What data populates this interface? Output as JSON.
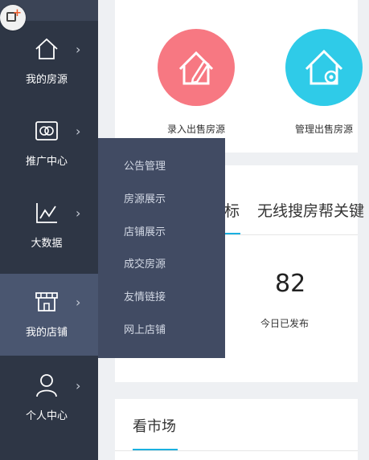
{
  "sidebar": {
    "items": [
      {
        "label": "我的房源",
        "icon": "house-icon"
      },
      {
        "label": "推广中心",
        "icon": "promotion-icon"
      },
      {
        "label": "大数据",
        "icon": "chart-icon"
      },
      {
        "label": "我的店铺",
        "icon": "store-icon"
      },
      {
        "label": "个人中心",
        "icon": "user-icon"
      }
    ]
  },
  "flyout": {
    "items": [
      "公告管理",
      "房源展示",
      "店铺展示",
      "成交房源",
      "友情链接",
      "网上店铺"
    ]
  },
  "quick_actions": [
    {
      "label": "录入出售房源",
      "icon": "house-edit-icon",
      "color": "#f77882"
    },
    {
      "label": "管理出售房源",
      "icon": "house-settings-icon",
      "color": "#2fcbe8"
    }
  ],
  "tabs": {
    "partial_tab": "标",
    "second_tab": "无线搜房帮关键"
  },
  "stats": {
    "value": "82",
    "label": "今日已发布"
  },
  "market": {
    "title": "看市场"
  },
  "colors": {
    "sidebar_bg": "#2e3645",
    "active_bg": "#4a5670",
    "flyout_bg": "#414b63",
    "accent": "#1ab0e0"
  }
}
